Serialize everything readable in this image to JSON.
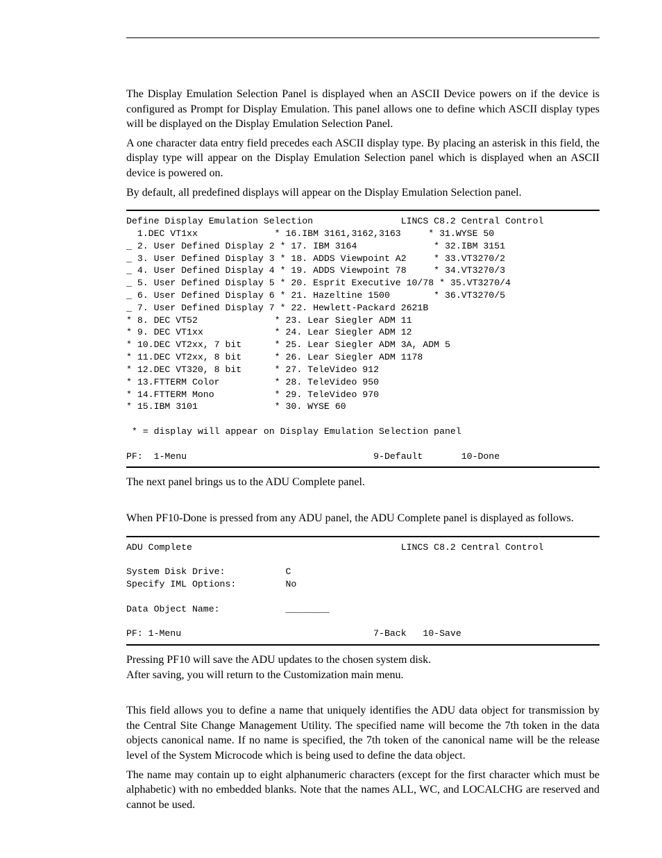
{
  "intro": {
    "p1": "The Display Emulation Selection Panel is displayed when an ASCII Device powers on if the device is configured as Prompt for Display Emulation. This panel allows one to define which ASCII display types will be displayed on the Display Emulation Selection Panel.",
    "p2": "A one character data entry field precedes each ASCII display type. By placing an asterisk in this field, the display type will appear on the Display Emulation Selection panel which is displayed when an ASCII device is powered on.",
    "p3": "By default, all predefined displays will appear on the Display Emulation Selection panel."
  },
  "panel1": {
    "header_left": "Define Display Emulation Selection",
    "header_right": "LINCS C8.2 Central Control",
    "lines": [
      "  1.DEC VT1xx              * 16.IBM 3161,3162,3163     * 31.WYSE 50",
      "_ 2. User Defined Display 2 * 17. IBM 3164              * 32.IBM 3151",
      "_ 3. User Defined Display 3 * 18. ADDS Viewpoint A2     * 33.VT3270/2",
      "_ 4. User Defined Display 4 * 19. ADDS Viewpoint 78     * 34.VT3270/3",
      "_ 5. User Defined Display 5 * 20. Esprit Executive 10/78 * 35.VT3270/4",
      "_ 6. User Defined Display 6 * 21. Hazeltine 1500        * 36.VT3270/5",
      "_ 7. User Defined Display 7 * 22. Hewlett-Packard 2621B",
      "* 8. DEC VT52              * 23. Lear Siegler ADM 11",
      "* 9. DEC VT1xx             * 24. Lear Siegler ADM 12",
      "* 10.DEC VT2xx, 7 bit      * 25. Lear Siegler ADM 3A, ADM 5",
      "* 11.DEC VT2xx, 8 bit      * 26. Lear Siegler ADM 1178",
      "* 12.DEC VT320, 8 bit      * 27. TeleVideo 912",
      "* 13.FTTERM Color          * 28. TeleVideo 950",
      "* 14.FTTERM Mono           * 29. TeleVideo 970",
      "* 15.IBM 3101              * 30. WYSE 60"
    ],
    "note": " * = display will appear on Display Emulation Selection panel",
    "pf": "PF:  1-Menu                                  9-Default       10-Done"
  },
  "mid": {
    "p4": "The next panel brings us to the ADU Complete panel.",
    "p5": "When PF10-Done is pressed from any ADU panel, the ADU Complete panel is displayed as follows."
  },
  "panel2": {
    "header_left": "ADU Complete",
    "header_right": "LINCS C8.2 Central Control",
    "line1": "System Disk Drive:           C",
    "line2": "Specify IML Options:         No",
    "line3": "Data Object Name:            ________",
    "pf": "PF: 1-Menu                                   7-Back   10-Save"
  },
  "outro": {
    "p6": "Pressing PF10 will save the ADU updates to the chosen system disk.",
    "p7": "After saving, you will return to the Customization main menu.",
    "p8": "This field allows you to define a name that uniquely identifies the ADU data object for transmission by the Central Site Change Management Utility. The specified name will become the 7th token in the data objects canonical name. If no name is specified, the 7th token of the canonical name will be the release level of the System Microcode which is being used to define the data object.",
    "p9": "The name may contain up to eight alphanumeric characters (except for the first character which must be alphabetic) with no embedded blanks. Note that the names ALL, WC, and LOCALCHG are reserved and cannot be used."
  }
}
